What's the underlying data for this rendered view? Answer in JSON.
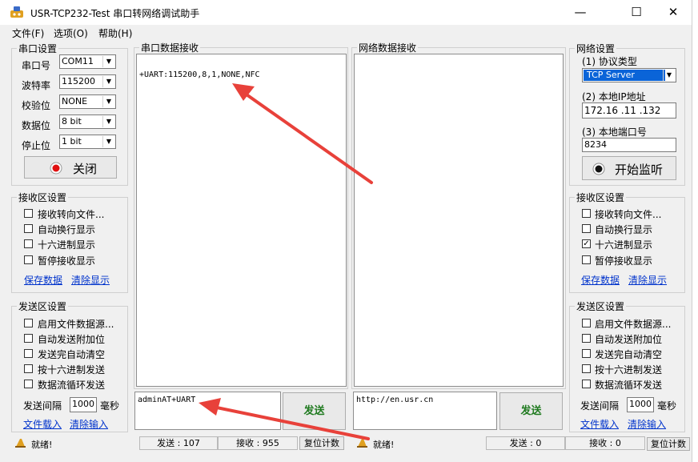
{
  "window": {
    "title": "USR-TCP232-Test 串口转网络调试助手",
    "minimize_glyph": "—",
    "maximize_glyph": "☐",
    "close_glyph": "✕"
  },
  "menu": {
    "file": "文件(F)",
    "options": "选项(O)",
    "help": "帮助(H)"
  },
  "serial_settings": {
    "legend": "串口设置",
    "port_label": "串口号",
    "port_value": "COM11",
    "baud_label": "波特率",
    "baud_value": "115200",
    "parity_label": "校验位",
    "parity_value": "NONE",
    "data_label": "数据位",
    "data_value": "8 bit",
    "stop_label": "停止位",
    "stop_value": "1 bit",
    "close_button": "关闭"
  },
  "left_recv": {
    "legend": "接收区设置",
    "opt1": "接收转向文件...",
    "opt2": "自动换行显示",
    "opt3": "十六进制显示",
    "opt4": "暂停接收显示",
    "link_save": "保存数据",
    "link_clear": "清除显示"
  },
  "left_send": {
    "legend": "发送区设置",
    "opt1": "启用文件数据源...",
    "opt2": "自动发送附加位",
    "opt3": "发送完自动清空",
    "opt4": "按十六进制发送",
    "opt5": "数据流循环发送",
    "interval_label": "发送间隔",
    "interval_value": "1000",
    "interval_unit": "毫秒",
    "link_load": "文件载入",
    "link_clear": "清除输入"
  },
  "serial_recv": {
    "legend": "串口数据接收",
    "content": "+UART:115200,8,1,NONE,NFC"
  },
  "net_recv": {
    "legend": "网络数据接收",
    "content": ""
  },
  "net_settings": {
    "legend": "网络设置",
    "proto_label": "(1) 协议类型",
    "proto_value": "TCP Server",
    "ip_label": "(2) 本地IP地址",
    "ip_value": "172.16 .11 .132",
    "port_label": "(3) 本地端口号",
    "port_value": "8234",
    "listen_button": "开始监听"
  },
  "right_recv": {
    "legend": "接收区设置",
    "opt1": "接收转向文件...",
    "opt2": "自动换行显示",
    "opt3": "十六进制显示",
    "opt4": "暂停接收显示",
    "link_save": "保存数据",
    "link_clear": "清除显示"
  },
  "right_send": {
    "legend": "发送区设置",
    "opt1": "启用文件数据源...",
    "opt2": "自动发送附加位",
    "opt3": "发送完自动清空",
    "opt4": "按十六进制发送",
    "opt5": "数据流循环发送",
    "interval_label": "发送间隔",
    "interval_value": "1000",
    "interval_unit": "毫秒",
    "link_load": "文件载入",
    "link_clear": "清除输入"
  },
  "serial_send": {
    "content": "adminAT+UART",
    "send_button": "发送"
  },
  "net_send": {
    "content": "http://en.usr.cn",
    "send_button": "发送"
  },
  "status_left": {
    "ready": "就绪!",
    "sent": "发送 : 107",
    "recv": "接收 : 955",
    "reset": "复位计数"
  },
  "status_right": {
    "ready": "就绪!",
    "sent": "发送 : 0",
    "recv": "接收 : 0",
    "reset": "复位计数"
  },
  "checked": {
    "left_hex_display": false,
    "right_hex_display": true
  },
  "colors": {
    "arrow": "#e8413a",
    "link": "#0033cc",
    "send_text": "#1f7a1f",
    "selection": "#0a64d8"
  }
}
